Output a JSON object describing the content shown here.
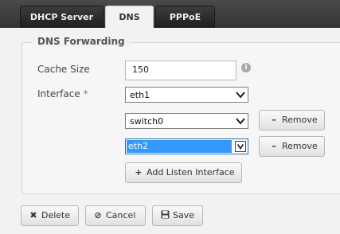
{
  "tabs": [
    {
      "label": "DHCP Server"
    },
    {
      "label": "DNS"
    },
    {
      "label": "PPPoE"
    }
  ],
  "section": {
    "title": "DNS Forwarding"
  },
  "cache_size": {
    "label": "Cache Size",
    "value": "150",
    "info_glyph": "i"
  },
  "interface": {
    "label": "Interface",
    "required_mark": "*",
    "selects": [
      {
        "value": "eth1"
      },
      {
        "value": "switch0",
        "remove_label": "Remove"
      },
      {
        "value": "eth2",
        "remove_label": "Remove"
      }
    ],
    "add_label": "Add Listen Interface"
  },
  "footer": {
    "delete_label": "Delete",
    "cancel_label": "Cancel",
    "save_label": "Save"
  },
  "colors": {
    "tab_bar": "#333333",
    "accent": "#3399ff",
    "required": "#3d8fd1"
  }
}
